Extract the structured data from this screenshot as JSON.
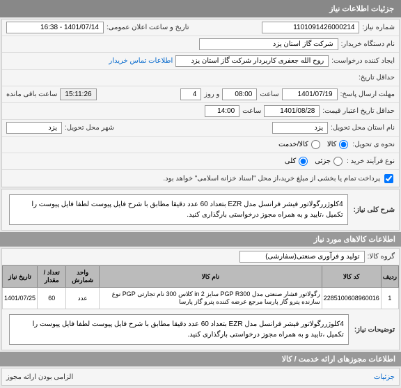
{
  "header": {
    "title": "جزئیات اطلاعات نیاز"
  },
  "fields": {
    "need_number_label": "شماره نیاز:",
    "need_number": "1101091426000214",
    "announce_label": "تاریخ و ساعت اعلان عمومی:",
    "announce_value": "1401/07/14 - 16:38",
    "buyer_label": "نام دستگاه خریدار:",
    "buyer_value": "شرکت گاز استان یزد",
    "requester_label": "ایجاد کننده درخواست:",
    "requester_value": "روح الله جعفری کاربردار شرکت گاز استان یزد",
    "contact_link": "اطلاعات تماس خریدار",
    "deadline_label": "حداقل تاریخ:",
    "reply_deadline_label": "مهلت ارسال پاسخ:",
    "reply_date": "1401/07/19",
    "time_label": "ساعت",
    "reply_time": "08:00",
    "day_label": "و روز",
    "days_value": "4",
    "countdown": "15:11:26",
    "remaining_label": "ساعت باقی مانده",
    "validity_label": "حداقل تاریخ اعتبار قیمت:",
    "validity_date": "1401/08/28",
    "validity_time": "14:00",
    "province_label": "نام استان محل تحویل:",
    "province_value": "یزد",
    "city_label": "شهر محل تحویل:",
    "city_value": "یزد",
    "delivery_type_label": "نحوه ی تحویل:",
    "goods": "کالا",
    "service": "کالا/خدمت",
    "purchase_type_label": "نوع فرآیند خرید :",
    "partial": "جزئی",
    "full": "کلی",
    "payment_note": "پرداخت تمام یا بخشی از مبلغ خرید،از محل \"اسناد خزانه اسلامی\" خواهد بود."
  },
  "need_desc": {
    "header": "شرح کلی نیاز:",
    "text": "4کلوژررگولاتور فیشر فرانسل مدل EZR بتعداد 60 عدد دقیقا مطابق با شرح فایل پیوست لطفا فایل پیوست را تکمیل ،تایید و به همراه مجوز درخواستی بارگذاری کنید."
  },
  "goods_info": {
    "header": "اطلاعات کالاهای مورد نیاز",
    "group_label": "گروه کالا:",
    "group_value": "تولید و فرآوری صنعتی(سفارشی)"
  },
  "table": {
    "headers": [
      "ردیف",
      "کد کالا",
      "نام کالا",
      "واحد شمارش",
      "تعداد / مقدار",
      "تاریخ نیاز"
    ],
    "row": {
      "idx": "1",
      "code": "2285100608960016",
      "name": "رگولاتور فشار صنعتی مدل PGP R300 سایز in 2 کلاس 300 نام تجارتی PGP نوع سازنده پترو گاز پارسا مرجع عرضه کننده پترو گاز پارسا",
      "unit": "عدد",
      "qty": "60",
      "date": "1401/07/25"
    }
  },
  "need_notes": {
    "label": "توضیحات نیاز:",
    "text": "4کلوژررگولاتور فیشر فرانسل مدل EZR بتعداد 60 عدد دقیقا مطابق با شرح فایل پیوست لطفا فایل پیوست را تکمیل ،تایید و به همراه مجوز درخواستی بارگذاری کنید."
  },
  "license": {
    "header": "اطلاعات مجوزهای ارائه خدمت / کالا",
    "details": "جزئیات",
    "mandatory_label": "الزامی بودن ارائه مجوز"
  }
}
